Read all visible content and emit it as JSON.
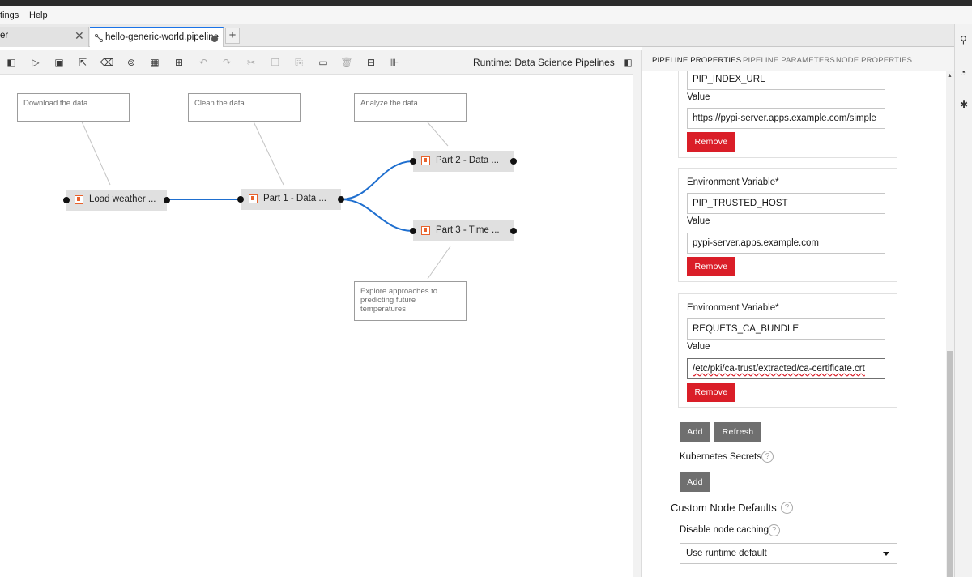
{
  "menu": {
    "items": [
      "tings",
      "Help"
    ]
  },
  "tabs": [
    {
      "label": "er",
      "close": "✕"
    },
    {
      "label": "hello-generic-world.pipeline",
      "icon": "pipeline-icon"
    }
  ],
  "tab_add": "+",
  "toolbar": {
    "runtime_label": "Runtime: Data Science Pipelines"
  },
  "canvas": {
    "comments": [
      "Download the data",
      "Clean the data",
      "Analyze the data",
      "Explore approaches to predicting future temperatures"
    ],
    "nodes": [
      "Load weather ...",
      "Part 1 - Data ...",
      "Part 2 - Data ...",
      "Part 3 - Time ..."
    ],
    "link_color": "#1f6fcf"
  },
  "panel": {
    "tabs": [
      "PIPELINE PROPERTIES",
      "PIPELINE PARAMETERS",
      "NODE PROPERTIES"
    ],
    "env_vars": [
      {
        "label": "",
        "name": "PIP_INDEX_URL",
        "value_label": "Value",
        "value": "https://pypi-server.apps.example.com/simple",
        "remove": "Remove"
      },
      {
        "label": "Environment Variable*",
        "name": "PIP_TRUSTED_HOST",
        "value_label": "Value",
        "value": "pypi-server.apps.example.com",
        "remove": "Remove"
      },
      {
        "label": "Environment Variable*",
        "name": "REQUETS_CA_BUNDLE",
        "value_label": "Value",
        "value": "/etc/pki/ca-trust/extracted/ca-certificate.crt",
        "remove": "Remove"
      }
    ],
    "env_add": "Add",
    "env_refresh": "Refresh",
    "k8s_secrets_label": "Kubernetes Secrets",
    "k8s_add": "Add",
    "custom_defaults_heading": "Custom Node Defaults",
    "disable_caching_label": "Disable node caching",
    "disable_caching_value": "Use runtime default",
    "help_glyph": "?"
  },
  "colors": {
    "accent": "#1a73e8",
    "danger": "#da1e28",
    "node_icon": "#e8622c"
  }
}
